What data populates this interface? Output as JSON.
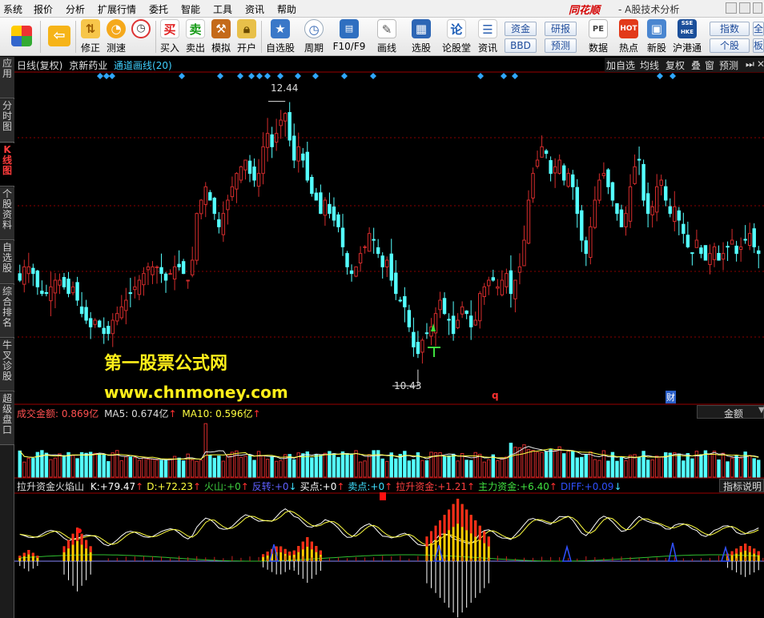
{
  "menu": [
    "系统",
    "报价",
    "分析",
    "扩展行情",
    "委托",
    "智能",
    "工具",
    "资讯",
    "帮助"
  ],
  "app": {
    "brand": "同花顺",
    "subtitle": "- A股技术分析"
  },
  "toolbar": {
    "buttons": [
      {
        "label": "",
        "icon": "grid-icon"
      },
      {
        "label": "",
        "icon": "back-arrow-icon"
      },
      {
        "label": "修正",
        "icon": "updown-arrow-icon"
      },
      {
        "label": "测速",
        "icon": "speed-icon"
      },
      {
        "label": "买入",
        "icon": "buy-icon"
      },
      {
        "label": "卖出",
        "icon": "sell-icon"
      },
      {
        "label": "模拟",
        "icon": "hammer-icon"
      },
      {
        "label": "开户",
        "icon": "lock-icon"
      },
      {
        "label": "自选股",
        "icon": "star-icon"
      },
      {
        "label": "周期",
        "icon": "clock-icon"
      },
      {
        "label": "F10/F9",
        "icon": "f10-icon"
      },
      {
        "label": "画线",
        "icon": "pen-icon"
      },
      {
        "label": "选股",
        "icon": "select-stock-icon"
      },
      {
        "label": "论股堂",
        "icon": "forum-icon"
      },
      {
        "label": "资讯",
        "icon": "news-icon"
      },
      {
        "label": "数据",
        "icon": "pe-data-icon"
      },
      {
        "label": "热点",
        "icon": "hot-icon"
      },
      {
        "label": "新股",
        "icon": "new-stock-icon"
      },
      {
        "label": "沪港通",
        "icon": "sse-hkex-icon"
      }
    ],
    "box_buttons": [
      "资金",
      "BBD",
      "研报",
      "预测",
      "指数",
      "个股",
      "全",
      "板"
    ]
  },
  "left_tabs": [
    {
      "label": "应用",
      "active": false
    },
    {
      "label": "分时图",
      "active": false
    },
    {
      "label": "K线图",
      "active": true
    },
    {
      "label": "个股资料",
      "active": false
    },
    {
      "label": "自选股",
      "active": false
    },
    {
      "label": "综合排名",
      "active": false
    },
    {
      "label": "牛叉诊股",
      "active": false
    },
    {
      "label": "超级盘口",
      "active": false
    }
  ],
  "chart_header": {
    "period": "日线(复权)",
    "stock_name": "京新药业",
    "indicator": "通道画线(20)",
    "buttons": [
      "加自选",
      "均线",
      "复权",
      "叠",
      "窗",
      "预测",
      "⏭",
      "✕"
    ]
  },
  "main_chart": {
    "high_label": "12.44",
    "low_label": "10.43",
    "marker_q": "q",
    "marker_cai": "财",
    "watermark_cn": "第一股票公式网",
    "watermark_url": "www.chnmoney.com"
  },
  "volume_panel": {
    "title": "成交金额:",
    "value": "0.869亿",
    "ma5_label": "MA5:",
    "ma5": "0.674亿",
    "ma10_label": "MA10:",
    "ma10": "0.596亿",
    "dropdown": "金额"
  },
  "indicator_panel": {
    "name": "拉升资金火焰山",
    "items": [
      {
        "label": "K:",
        "value": "+79.47",
        "color": "#ffffff"
      },
      {
        "label": "D:",
        "value": "+72.23",
        "color": "#ffff40"
      },
      {
        "label": "火山:",
        "value": "+0",
        "color": "#40d040"
      },
      {
        "label": "反转:",
        "value": "+0",
        "color": "#6060ff"
      },
      {
        "label": "买点:",
        "value": "+0",
        "color": "#ffffff"
      },
      {
        "label": "卖点:",
        "value": "+0",
        "color": "#40e0ff"
      },
      {
        "label": "拉升资金:",
        "value": "+1.21",
        "color": "#ff4040"
      },
      {
        "label": "主力资金:",
        "value": "+6.40",
        "color": "#40e040"
      },
      {
        "label": "DIFF:",
        "value": "+0.09",
        "color": "#3050ff"
      }
    ],
    "explain_btn": "指标说明"
  },
  "colors": {
    "up": "#d42c2c",
    "down": "#54ffff",
    "grid": "#8b0000",
    "diamond": "#2fa7ff"
  },
  "chart_data": {
    "type": "candlestick",
    "stock": "京新药业",
    "period": "daily",
    "price_range": [
      10.2,
      12.6
    ],
    "price_labels": {
      "max": 12.44,
      "min": 10.43
    },
    "close_series": [
      11.1,
      11.2,
      11.2,
      11.15,
      11.05,
      11.0,
      11.0,
      11.05,
      11.1,
      11.1,
      11.05,
      11.0,
      11.05,
      10.95,
      10.85,
      10.8,
      10.75,
      10.8,
      10.75,
      10.7,
      10.7,
      10.8,
      10.85,
      10.9,
      10.95,
      11.0,
      11.05,
      11.1,
      11.15,
      11.2,
      11.2,
      11.2,
      11.15,
      11.1,
      11.15,
      11.2,
      11.2,
      11.15,
      11.1,
      11.25,
      11.6,
      11.7,
      11.8,
      11.7,
      11.6,
      11.5,
      11.6,
      11.7,
      11.8,
      11.9,
      11.95,
      12.0,
      11.9,
      11.85,
      11.9,
      12.1,
      12.2,
      12.1,
      12.2,
      12.3,
      12.35,
      12.15,
      12.0,
      12.1,
      12.0,
      11.85,
      11.75,
      11.7,
      11.6,
      11.7,
      11.6,
      11.55,
      11.5,
      11.35,
      11.2,
      11.15,
      11.2,
      11.3,
      11.35,
      11.45,
      11.4,
      11.3,
      11.2,
      11.25,
      11.1,
      11.0,
      10.95,
      10.9,
      10.75,
      10.6,
      10.55,
      10.65,
      10.7,
      10.75,
      10.85,
      10.95,
      10.85,
      10.8,
      10.7,
      10.8,
      10.9,
      10.85,
      10.75,
      10.8,
      11.0,
      11.05,
      11.1,
      11.1,
      11.05,
      11.1,
      11.15,
      11.0,
      11.1,
      11.2,
      11.4,
      11.7,
      11.9,
      12.0,
      12.1,
      12.05,
      11.9,
      11.95,
      12.0,
      11.85,
      11.9,
      11.8,
      11.6,
      11.4,
      11.3,
      11.5,
      11.7,
      11.85,
      11.9,
      11.8,
      11.7,
      11.6,
      11.5,
      11.6,
      11.8,
      11.95,
      12.0,
      11.7,
      11.6,
      11.65,
      11.8,
      11.85,
      11.7,
      11.6,
      11.65,
      11.55,
      11.45,
      11.35,
      11.3,
      11.4,
      11.3,
      11.25,
      11.3,
      11.35,
      11.25,
      11.3,
      11.35,
      11.4,
      11.3,
      11.35,
      11.4,
      11.45,
      11.35,
      11.3
    ]
  }
}
